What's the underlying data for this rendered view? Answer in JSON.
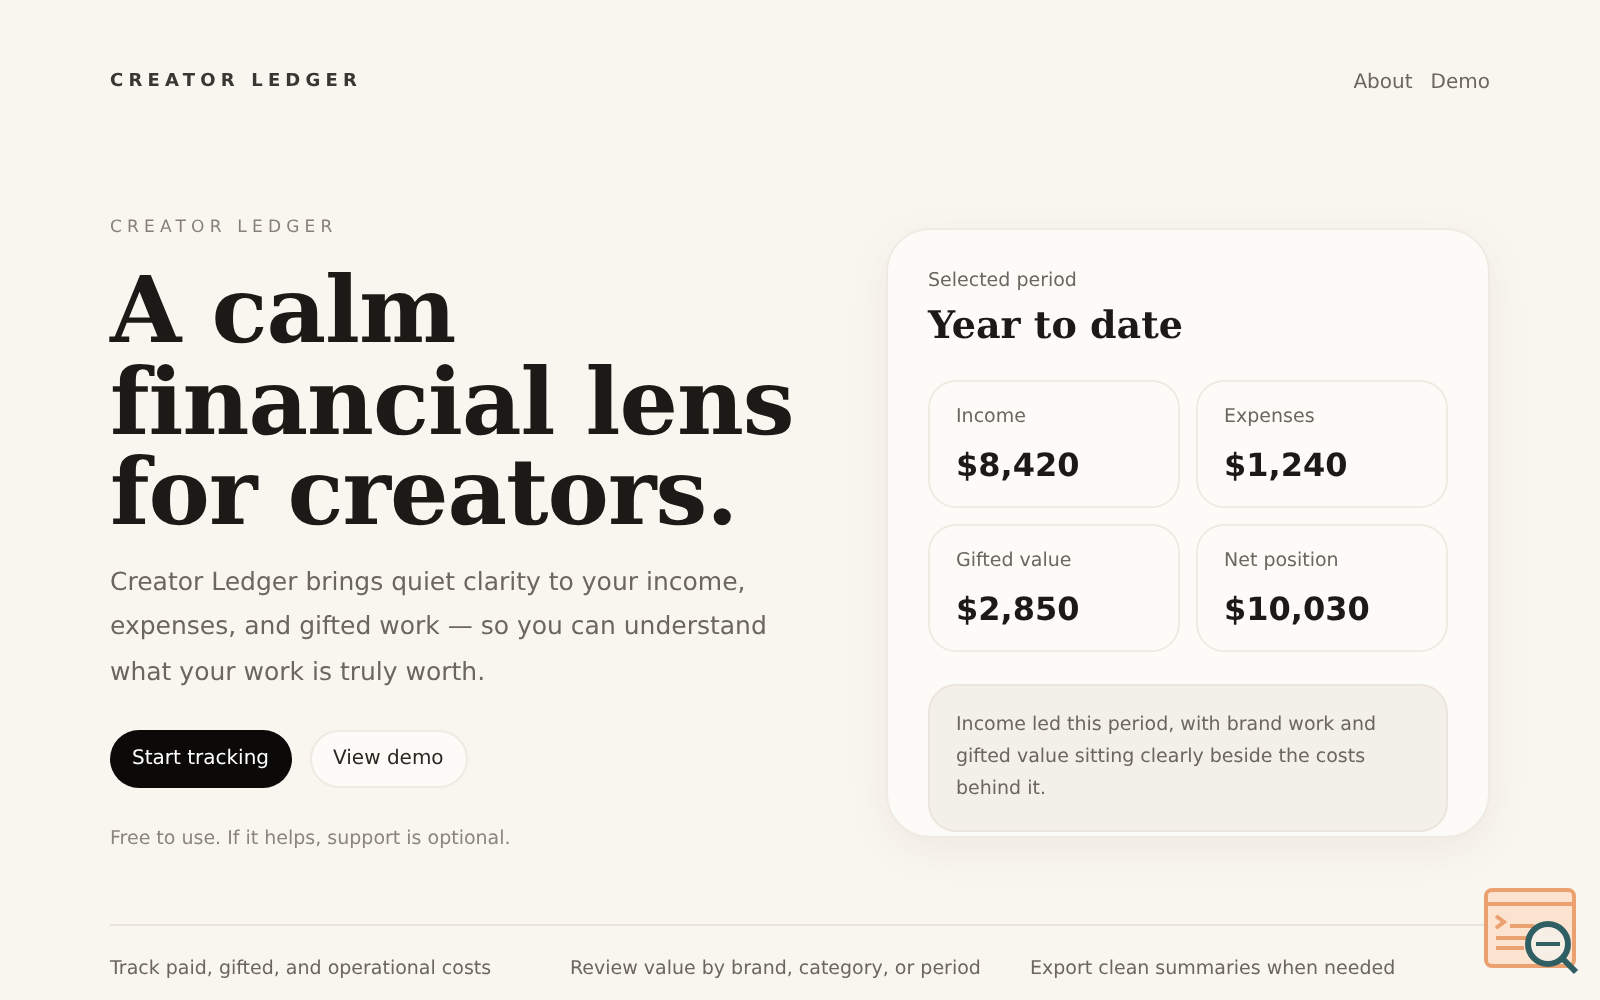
{
  "brand": "CREATOR LEDGER",
  "nav": [
    "About",
    "Demo"
  ],
  "hero": {
    "eyebrow": "CREATOR LEDGER",
    "headline": [
      "A calm",
      "financial lens",
      "for creators."
    ],
    "description": "Creator Ledger brings quiet clarity to your income, expenses, and gifted work — so you can understand what your work is truly worth.",
    "buttons": [
      {
        "label": "Start tracking",
        "kind": "primary"
      },
      {
        "label": "View demo",
        "kind": "secondary"
      }
    ],
    "note": "Free to use. If it helps, support is optional."
  },
  "summary": {
    "label": "Selected period",
    "title": "Year to date",
    "metrics": [
      {
        "label": "Income",
        "value": "$8,420"
      },
      {
        "label": "Expenses",
        "value": "$1,240"
      },
      {
        "label": "Gifted value",
        "value": "$2,850"
      },
      {
        "label": "Net position",
        "value": "$10,030"
      }
    ],
    "insight": "Income led this period, with brand work and gifted value sitting clearly beside the costs behind it."
  },
  "features": [
    "Track paid, gifted, and operational costs",
    "Review value by brand, category, or period",
    "Export clean summaries when needed"
  ]
}
